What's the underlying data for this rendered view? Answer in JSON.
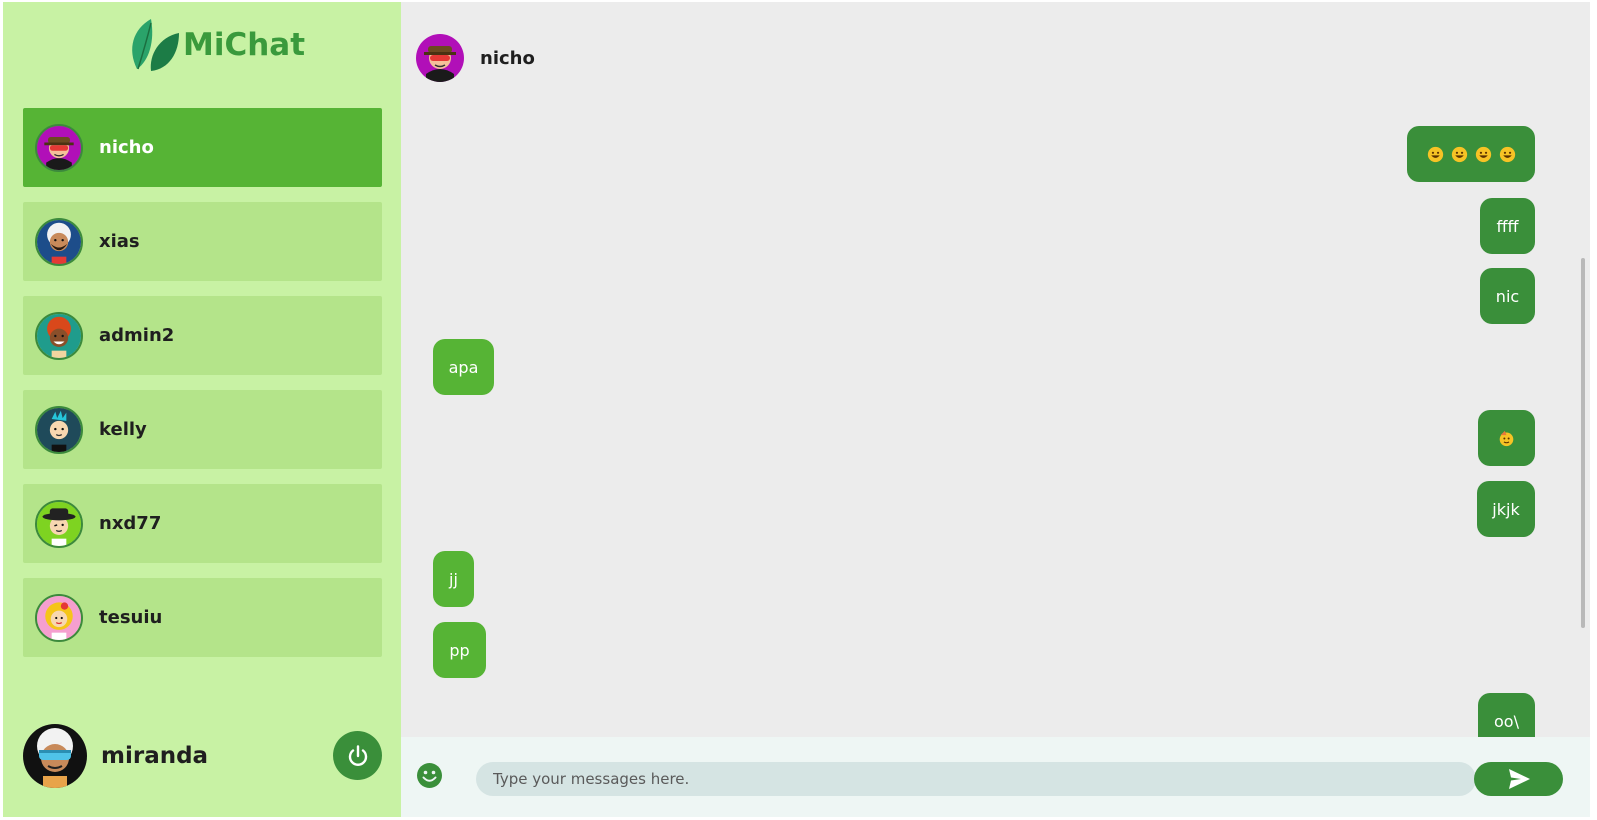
{
  "app": {
    "name": "MiChat",
    "brand_color": "#3a9a3c"
  },
  "contacts": [
    {
      "name": "nicho",
      "active": true,
      "avatar_icon": "avatar-bandit-icon"
    },
    {
      "name": "xias",
      "active": false,
      "avatar_icon": "avatar-bearded-man-icon"
    },
    {
      "name": "admin2",
      "active": false,
      "avatar_icon": "avatar-redhead-icon"
    },
    {
      "name": "kelly",
      "active": false,
      "avatar_icon": "avatar-punk-icon"
    },
    {
      "name": "nxd77",
      "active": false,
      "avatar_icon": "avatar-fedora-icon"
    },
    {
      "name": "tesuiu",
      "active": false,
      "avatar_icon": "avatar-blonde-icon"
    }
  ],
  "current_user": {
    "name": "miranda",
    "avatar_icon": "avatar-vr-goggles-icon"
  },
  "chat": {
    "partner": "nicho",
    "messages": [
      {
        "dir": "out",
        "kind": "emoji",
        "text": "😀😀😀😀"
      },
      {
        "dir": "out",
        "kind": "text",
        "text": "ffff"
      },
      {
        "dir": "out",
        "kind": "text",
        "text": "nic"
      },
      {
        "dir": "in",
        "kind": "text",
        "text": "apa"
      },
      {
        "dir": "out",
        "kind": "emoji",
        "text": "🥳"
      },
      {
        "dir": "out",
        "kind": "text",
        "text": "jkjk"
      },
      {
        "dir": "in",
        "kind": "text",
        "text": "jj"
      },
      {
        "dir": "in",
        "kind": "text",
        "text": "pp"
      },
      {
        "dir": "out",
        "kind": "text",
        "text": "oo\\"
      }
    ]
  },
  "composer": {
    "placeholder": "Type your messages here."
  },
  "colors": {
    "sidebar_bg": "#c8f2a4",
    "contact_bg": "#b4e48a",
    "contact_active_bg": "#56b435",
    "outgoing_bubble": "#3a8f3a",
    "incoming_bubble": "#56b435",
    "chat_bg": "#ececec"
  }
}
